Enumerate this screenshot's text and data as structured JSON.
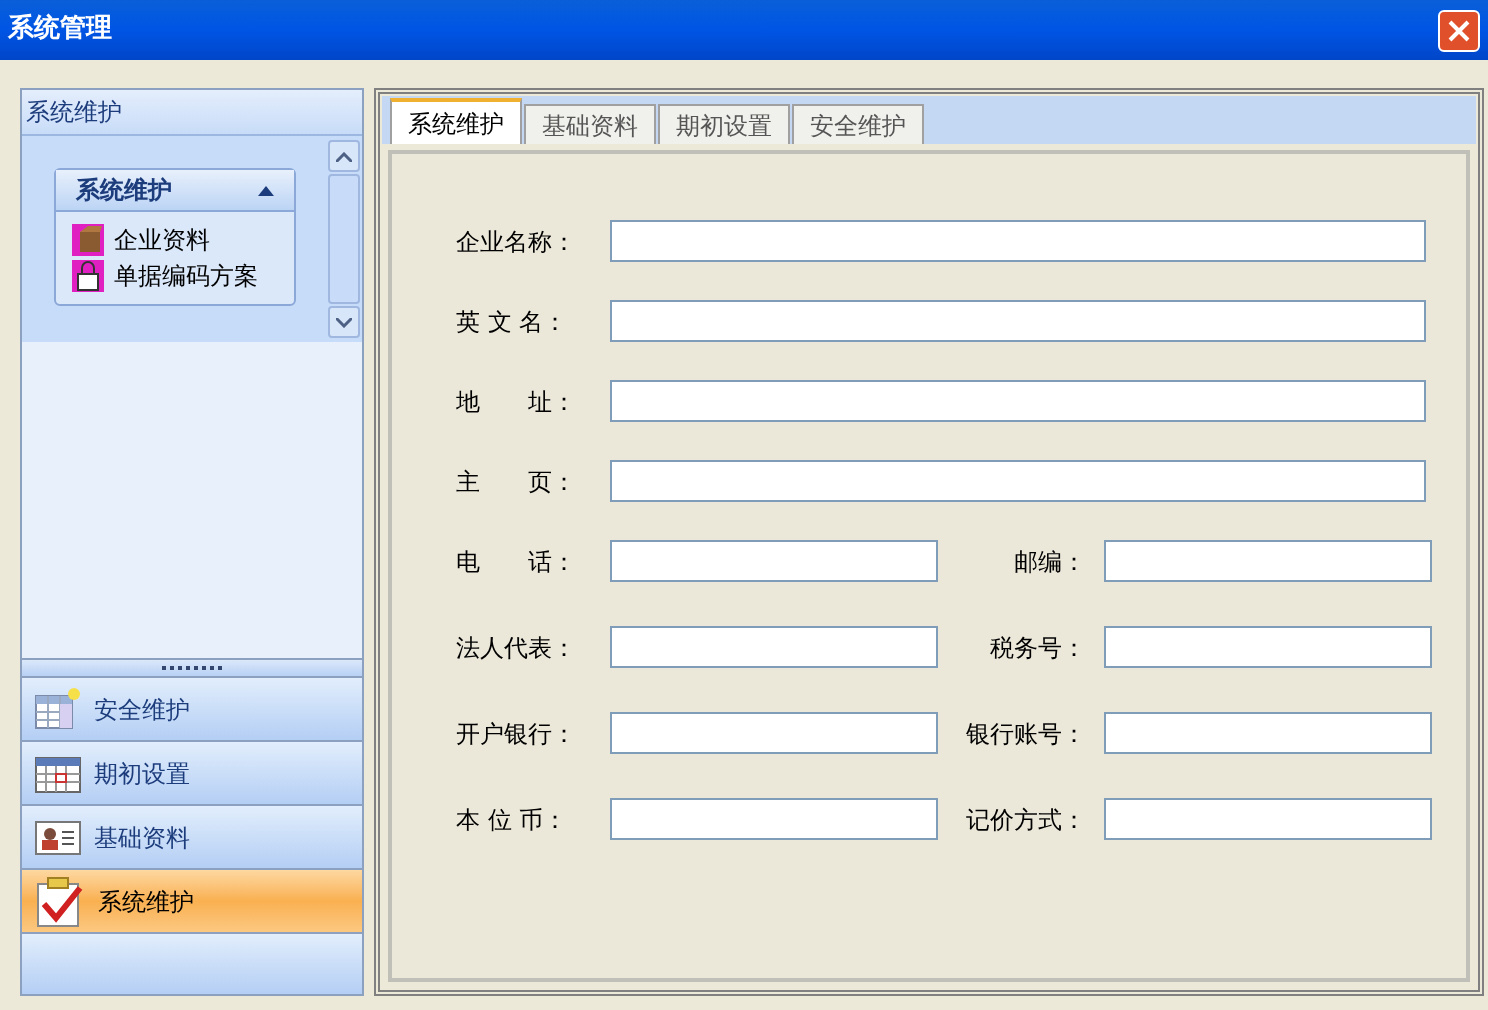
{
  "window": {
    "title": "系统管理"
  },
  "sidebar": {
    "header": "系统维护",
    "group": {
      "title": "系统维护",
      "expanded": true,
      "items": [
        {
          "label": "企业资料",
          "kind": "box"
        },
        {
          "label": "单据编码方案",
          "kind": "bag"
        }
      ]
    },
    "nav": [
      {
        "label": "安全维护",
        "kind": "table",
        "selected": false
      },
      {
        "label": "期初设置",
        "kind": "calendar",
        "selected": false
      },
      {
        "label": "基础资料",
        "kind": "card",
        "selected": false
      },
      {
        "label": "系统维护",
        "kind": "check",
        "selected": true
      }
    ]
  },
  "tabs": [
    {
      "label": "系统维护",
      "selected": true
    },
    {
      "label": "基础资料",
      "selected": false
    },
    {
      "label": "期初设置",
      "selected": false
    },
    {
      "label": "安全维护",
      "selected": false
    }
  ],
  "form": {
    "wide_fields": [
      {
        "label": "企业名称："
      },
      {
        "label": "英 文 名："
      },
      {
        "label": "地　　址："
      },
      {
        "label": "主　　页："
      }
    ],
    "pair_rows": [
      [
        {
          "label": "电　　话："
        },
        {
          "label": "邮编："
        }
      ],
      [
        {
          "label": "法人代表："
        },
        {
          "label": "税务号："
        }
      ],
      [
        {
          "label": "开户银行："
        },
        {
          "label": "银行账号："
        }
      ],
      [
        {
          "label": "本 位 币："
        },
        {
          "label": "记价方式："
        }
      ]
    ]
  }
}
